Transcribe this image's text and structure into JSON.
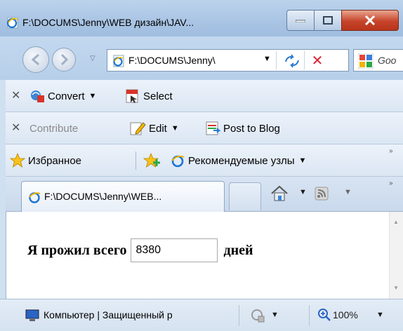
{
  "window": {
    "title": "F:\\DOCUMS\\Jenny\\WEB дизайн\\JAV..."
  },
  "nav": {
    "address_text": "F:\\DOCUMS\\Jenny\\",
    "search_text": "Goo"
  },
  "toolbar_convert": {
    "convert_label": "Convert",
    "select_label": "Select"
  },
  "toolbar_contribute": {
    "contribute_label": "Contribute",
    "edit_label": "Edit",
    "post_label": "Post to Blog"
  },
  "favorites": {
    "favorites_label": "Избранное",
    "suggested_label": "Рекомендуемые узлы",
    "overflow_glyph": "»"
  },
  "tabs": {
    "active_tab_label": "F:\\DOCUMS\\Jenny\\WEB...",
    "overflow_glyph": "»"
  },
  "content": {
    "lead_text": "Я прожил всего",
    "days_value": "8380",
    "trail_text": "дней"
  },
  "status": {
    "zone_text": "Компьютер | Защищенный р",
    "zoom_text": "100%"
  },
  "colors": {
    "titlebar": "#a9c4e4",
    "close_button": "#c6442a",
    "toolbar": "#e4ecf6",
    "content_bg": "#ffffff"
  },
  "icons": [
    "ie-page-icon",
    "back-icon",
    "forward-icon",
    "refresh-icon",
    "stop-icon",
    "search-provider-icon",
    "convert-pdf-icon",
    "select-pdf-icon",
    "edit-icon",
    "post-blog-icon",
    "favorites-star-icon",
    "add-favorites-icon",
    "home-icon",
    "feed-icon",
    "computer-zone-icon",
    "protected-mode-icon",
    "zoom-icon"
  ]
}
